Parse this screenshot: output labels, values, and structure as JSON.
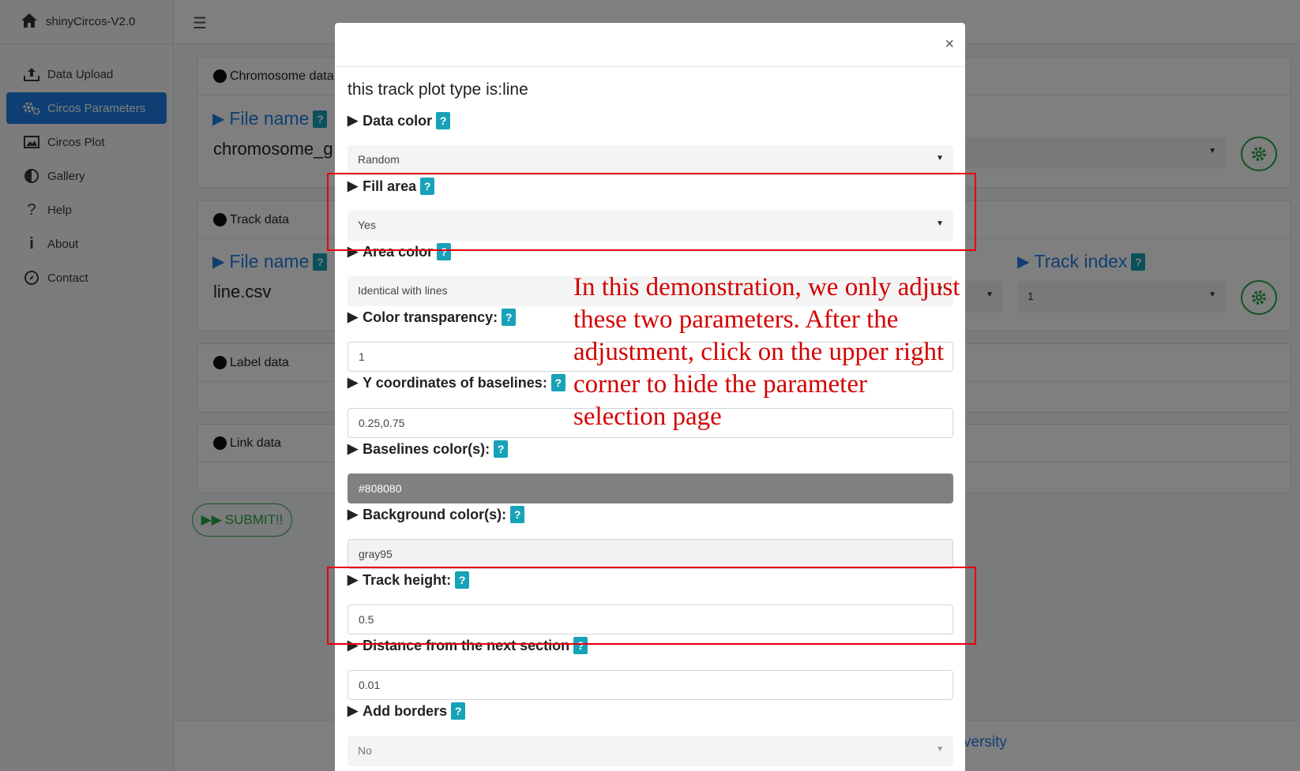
{
  "app": {
    "title": "shinyCircos-V2.0"
  },
  "sidebar": {
    "items": [
      {
        "label": "Data Upload",
        "icon": "upload-icon"
      },
      {
        "label": "Circos Parameters",
        "icon": "gears-icon",
        "active": true
      },
      {
        "label": "Circos Plot",
        "icon": "image-icon"
      },
      {
        "label": "Gallery",
        "icon": "adjust-icon"
      },
      {
        "label": "Help",
        "icon": "question-icon"
      },
      {
        "label": "About",
        "icon": "info-icon"
      },
      {
        "label": "Contact",
        "icon": "compass-icon"
      }
    ]
  },
  "background": {
    "chromosome_card": {
      "title": "Chromosome data",
      "file_label": "File name",
      "file_value": "chromosome_g"
    },
    "track_card": {
      "title": "Track data",
      "file_label": "File name",
      "file_value": "line.csv",
      "track_index_label": "Track index",
      "track_index_value": "1"
    },
    "label_card": {
      "title": "Label data"
    },
    "link_card": {
      "title": "Link data"
    },
    "submit_label": "SUBMIT!!",
    "footer_text": "versity",
    "help_badge": "?"
  },
  "modal": {
    "close_label": "×",
    "title": "this track plot type is:line",
    "fields": {
      "data_color": {
        "label": "Data color",
        "value": "Random"
      },
      "fill_area": {
        "label": "Fill area",
        "value": "Yes"
      },
      "area_color": {
        "label": "Area color",
        "value": "Identical with lines"
      },
      "color_transparency": {
        "label": "Color transparency:",
        "value": "1"
      },
      "y_baselines": {
        "label": "Y coordinates of baselines:",
        "value": "0.25,0.75"
      },
      "baselines_color": {
        "label": "Baselines color(s):",
        "value": "#808080"
      },
      "background_color": {
        "label": "Background color(s):",
        "value": "gray95"
      },
      "track_height": {
        "label": "Track height:",
        "value": "0.5"
      },
      "distance_next": {
        "label": "Distance from the next section",
        "value": "0.01"
      },
      "add_borders": {
        "label": "Add borders",
        "value": "No"
      }
    }
  },
  "annotation": {
    "note": "In this demonstration, we only adjust these two parameters. After the adjustment, click on the upper right corner to hide the parameter selection page",
    "color": "#e8000d"
  },
  "colors": {
    "accent": "#1f7ee4",
    "badge": "#17a2b8",
    "success": "#28a745"
  }
}
